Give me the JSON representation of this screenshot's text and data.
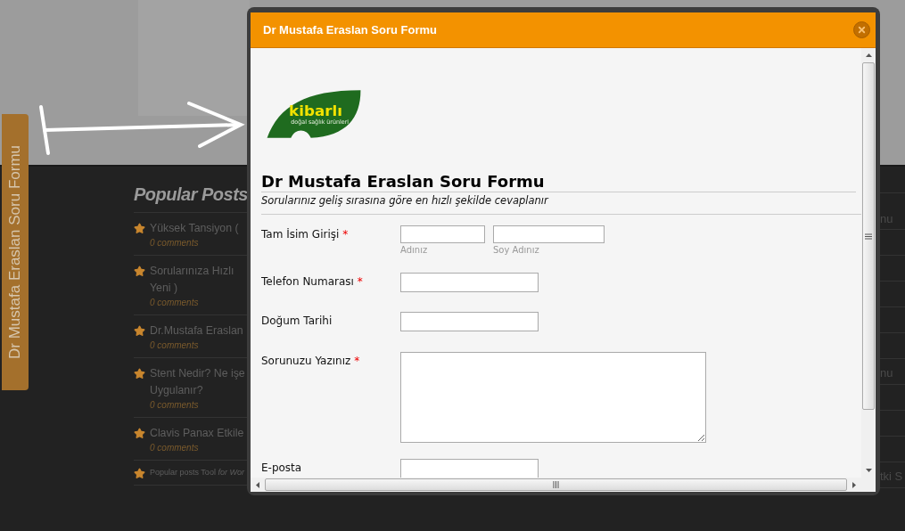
{
  "side_tab": {
    "label": "Dr Mustafa Eraslan Soru Formu"
  },
  "popular_posts": {
    "title": "Popular Posts",
    "items": [
      {
        "lines": [
          "Yüksek Tansiyon ("
        ],
        "comments": "0 comments"
      },
      {
        "lines": [
          "Sorularınıza Hızlı",
          "Yeni )"
        ],
        "comments": "0 comments"
      },
      {
        "lines": [
          "Dr.Mustafa Eraslan"
        ],
        "comments": "0 comments"
      },
      {
        "lines": [
          "Stent Nedir? Ne işe",
          "Uygulanır?"
        ],
        "comments": "0 comments"
      },
      {
        "lines": [
          "Clavis Panax Etkile"
        ],
        "comments": "0 comments"
      }
    ],
    "footer": "Popular posts Tool",
    "footer_italic": "for Wor"
  },
  "right_column": [
    "nu",
    "nu",
    "tki S"
  ],
  "dialog": {
    "title": "Dr Mustafa Eraslan Soru Formu",
    "logo": {
      "text": "kibarlı",
      "tagline": "doğal sağlık ürünleri"
    },
    "form_title": "Dr Mustafa Eraslan Soru Formu",
    "form_subtitle": "Sorularınız geliş sırasına göre en hızlı şekilde cevaplanır",
    "required_mark": "*",
    "fields": [
      {
        "kind": "name",
        "label": "Tam İsim Girişi",
        "required": true,
        "sublabels": [
          "Adınız",
          "Soy Adınız"
        ]
      },
      {
        "kind": "text",
        "label": "Telefon Numarası",
        "required": true
      },
      {
        "kind": "text",
        "label": "Doğum Tarihi",
        "required": false
      },
      {
        "kind": "textarea",
        "label": "Sorunuzu Yazınız",
        "required": true
      },
      {
        "kind": "text",
        "label": "E-posta",
        "required": false
      }
    ]
  }
}
